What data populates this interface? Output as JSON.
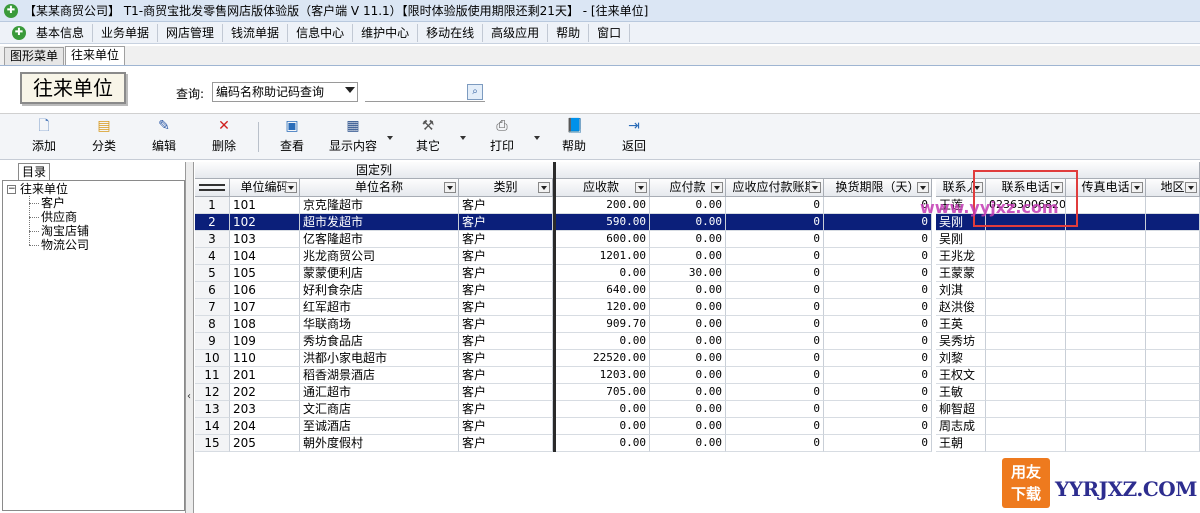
{
  "window": {
    "title": "【某某商贸公司】 T1-商贸宝批发零售网店版体验版（客户端 V 11.1）【限时体验版使用期限还剩21天】 - [往来单位]"
  },
  "menu": [
    "基本信息",
    "业务单据",
    "网店管理",
    "钱流单据",
    "信息中心",
    "维护中心",
    "移动在线",
    "高级应用",
    "帮助",
    "窗口"
  ],
  "tabs": [
    "图形菜单",
    "往来单位"
  ],
  "page": {
    "title": "往来单位",
    "query_label": "查询:",
    "query_option": "编码名称助记码查询",
    "search_value": ""
  },
  "toolbar": {
    "add": "添加",
    "category": "分类",
    "edit": "编辑",
    "delete": "删除",
    "view": "查看",
    "display": "显示内容",
    "other": "其它",
    "print": "打印",
    "help": "帮助",
    "back": "返回"
  },
  "tree": {
    "tab": "目录",
    "root": "往来单位",
    "children": [
      "客户",
      "供应商",
      "淘宝店铺",
      "物流公司"
    ]
  },
  "grid": {
    "fixed_label": "固定列",
    "columns": [
      "单位编码",
      "单位名称",
      "类别",
      "应收款",
      "应付款",
      "应收应付款账期",
      "换货期限（天）",
      "联系人",
      "联系电话",
      "传真电话",
      "地区"
    ],
    "selected_row": 1,
    "rows": [
      {
        "no": "1",
        "code": "101",
        "name": "京克隆超市",
        "type": "客户",
        "ar": "200.00",
        "ap": "0.00",
        "term": "0",
        "exch": "0",
        "contact": "王莲",
        "phone": "02363006820"
      },
      {
        "no": "2",
        "code": "102",
        "name": "超市发超市",
        "type": "客户",
        "ar": "590.00",
        "ap": "0.00",
        "term": "0",
        "exch": "0",
        "contact": "吴刚",
        "phone": ""
      },
      {
        "no": "3",
        "code": "103",
        "name": "亿客隆超市",
        "type": "客户",
        "ar": "600.00",
        "ap": "0.00",
        "term": "0",
        "exch": "0",
        "contact": "吴刚",
        "phone": ""
      },
      {
        "no": "4",
        "code": "104",
        "name": "兆龙商贸公司",
        "type": "客户",
        "ar": "1201.00",
        "ap": "0.00",
        "term": "0",
        "exch": "0",
        "contact": "王兆龙",
        "phone": ""
      },
      {
        "no": "5",
        "code": "105",
        "name": "蒙蒙便利店",
        "type": "客户",
        "ar": "0.00",
        "ap": "30.00",
        "term": "0",
        "exch": "0",
        "contact": "王蒙蒙",
        "phone": ""
      },
      {
        "no": "6",
        "code": "106",
        "name": "好利食杂店",
        "type": "客户",
        "ar": "640.00",
        "ap": "0.00",
        "term": "0",
        "exch": "0",
        "contact": "刘淇",
        "phone": ""
      },
      {
        "no": "7",
        "code": "107",
        "name": "红军超市",
        "type": "客户",
        "ar": "120.00",
        "ap": "0.00",
        "term": "0",
        "exch": "0",
        "contact": "赵洪俊",
        "phone": ""
      },
      {
        "no": "8",
        "code": "108",
        "name": "华联商场",
        "type": "客户",
        "ar": "909.70",
        "ap": "0.00",
        "term": "0",
        "exch": "0",
        "contact": "王英",
        "phone": ""
      },
      {
        "no": "9",
        "code": "109",
        "name": "秀坊食品店",
        "type": "客户",
        "ar": "0.00",
        "ap": "0.00",
        "term": "0",
        "exch": "0",
        "contact": "吴秀坊",
        "phone": ""
      },
      {
        "no": "10",
        "code": "110",
        "name": "洪都小家电超市",
        "type": "客户",
        "ar": "22520.00",
        "ap": "0.00",
        "term": "0",
        "exch": "0",
        "contact": "刘黎",
        "phone": ""
      },
      {
        "no": "11",
        "code": "201",
        "name": "稻香湖景酒店",
        "type": "客户",
        "ar": "1203.00",
        "ap": "0.00",
        "term": "0",
        "exch": "0",
        "contact": "王权文",
        "phone": ""
      },
      {
        "no": "12",
        "code": "202",
        "name": "通汇超市",
        "type": "客户",
        "ar": "705.00",
        "ap": "0.00",
        "term": "0",
        "exch": "0",
        "contact": "王敏",
        "phone": ""
      },
      {
        "no": "13",
        "code": "203",
        "name": "文汇商店",
        "type": "客户",
        "ar": "0.00",
        "ap": "0.00",
        "term": "0",
        "exch": "0",
        "contact": "柳智超",
        "phone": ""
      },
      {
        "no": "14",
        "code": "204",
        "name": "至诚酒店",
        "type": "客户",
        "ar": "0.00",
        "ap": "0.00",
        "term": "0",
        "exch": "0",
        "contact": "周志成",
        "phone": ""
      },
      {
        "no": "15",
        "code": "205",
        "name": "朝外度假村",
        "type": "客户",
        "ar": "0.00",
        "ap": "0.00",
        "term": "0",
        "exch": "0",
        "contact": "王朝",
        "phone": ""
      }
    ]
  },
  "watermark": "www.yyjxz.com",
  "logo": {
    "left": "用友",
    "left2": "下载",
    "right": "YYRJXZ.COM"
  }
}
